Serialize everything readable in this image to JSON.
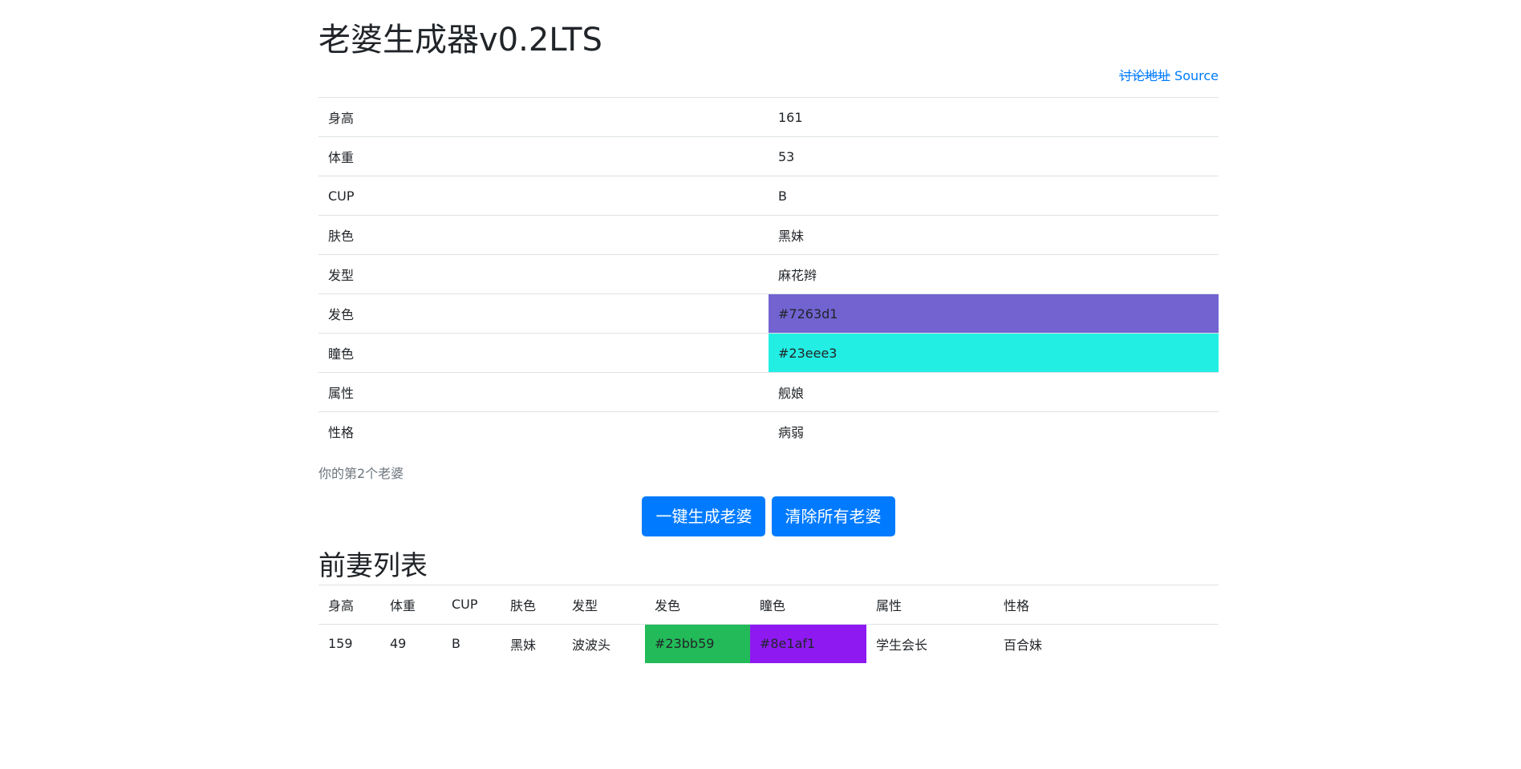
{
  "header": {
    "title": "老婆生成器v0.2LTS",
    "discussion_link": "讨论地址",
    "source_link": "Source"
  },
  "current": {
    "rows": [
      {
        "key": "身高",
        "value": "161"
      },
      {
        "key": "体重",
        "value": "53"
      },
      {
        "key": "CUP",
        "value": "B"
      },
      {
        "key": "肤色",
        "value": "黑妹"
      },
      {
        "key": "发型",
        "value": "麻花辫"
      },
      {
        "key": "发色",
        "value": "#7263d1"
      },
      {
        "key": "瞳色",
        "value": "#23eee3"
      },
      {
        "key": "属性",
        "value": "舰娘"
      },
      {
        "key": "性格",
        "value": "病弱"
      }
    ],
    "hair_color": "#7263d1",
    "eye_color": "#23eee3",
    "count_text": "你的第2个老婆"
  },
  "buttons": {
    "generate": "一键生成老婆",
    "clear": "清除所有老婆"
  },
  "exes": {
    "title": "前妻列表",
    "headers": [
      "身高",
      "体重",
      "CUP",
      "肤色",
      "发型",
      "发色",
      "瞳色",
      "属性",
      "性格"
    ],
    "rows": [
      {
        "cells": [
          "159",
          "49",
          "B",
          "黑妹",
          "波波头",
          "#23bb59",
          "#8e1af1",
          "学生会长",
          "百合妹"
        ],
        "hair_color": "#23bb59",
        "eye_color": "#8e1af1"
      }
    ]
  }
}
